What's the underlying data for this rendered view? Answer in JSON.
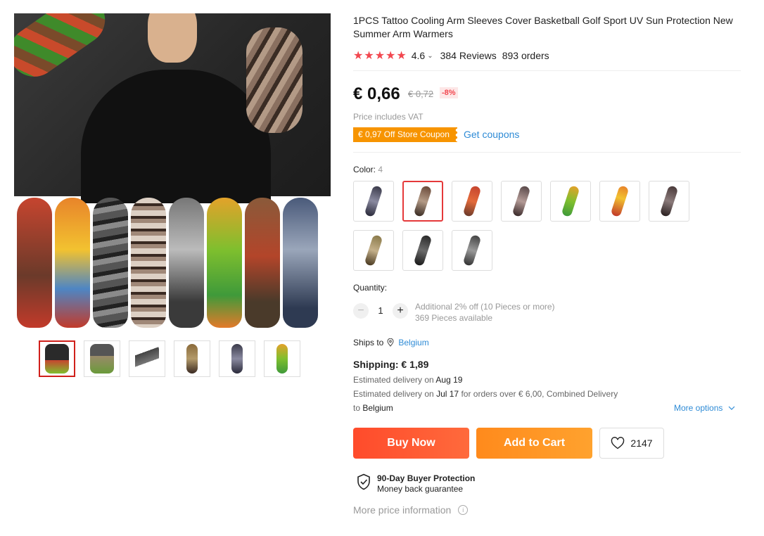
{
  "product": {
    "title": "1PCS Tattoo Cooling Arm Sleeves Cover Basketball Golf Sport UV Sun Protection New Summer Arm Warmers",
    "stars": "★★★★★",
    "rating": "4.6",
    "reviews": "384 Reviews",
    "orders": "893 orders"
  },
  "price": {
    "current": "€ 0,66",
    "original": "€ 0,72",
    "discount": "-8%",
    "vat_note": "Price includes VAT",
    "coupon": "€ 0,97 Off Store Coupon",
    "get_coupons": "Get coupons"
  },
  "color": {
    "label": "Color:",
    "value": "4",
    "selected_index": 1,
    "swatches": [
      {
        "name": "swatch-1"
      },
      {
        "name": "swatch-2"
      },
      {
        "name": "swatch-3"
      },
      {
        "name": "swatch-4"
      },
      {
        "name": "swatch-5"
      },
      {
        "name": "swatch-6"
      },
      {
        "name": "swatch-7"
      },
      {
        "name": "swatch-8"
      },
      {
        "name": "swatch-9"
      },
      {
        "name": "swatch-10"
      }
    ]
  },
  "quantity": {
    "label": "Quantity:",
    "minus": "−",
    "plus": "+",
    "value": "1",
    "note_discount": "Additional 2% off (10 Pieces or more)",
    "note_available": "369 Pieces available"
  },
  "shipping": {
    "ships_to_label": "Ships to",
    "country": "Belgium",
    "cost": "Shipping: € 1,89",
    "est1_prefix": "Estimated delivery on",
    "est1_date": "Aug 19",
    "est2_prefix": "Estimated delivery on",
    "est2_date": "Jul 17",
    "est2_suffix": "for orders over € 6,00, Combined Delivery",
    "est3_prefix": "to",
    "est3_country": "Belgium",
    "more_options": "More options"
  },
  "actions": {
    "buy_now": "Buy Now",
    "add_to_cart": "Add to Cart",
    "wishlist_count": "2147"
  },
  "protection": {
    "title": "90-Day Buyer Protection",
    "subtitle": "Money back guarantee"
  },
  "more_price_info": "More price information",
  "colors": {
    "accent_red": "#f2474f",
    "coupon_orange": "#f79400",
    "link_blue": "#2e8bd6",
    "buy_now": "#ff4b2b",
    "add_to_cart": "#ff8a1c"
  },
  "gallery": {
    "thumbnails": [
      "thumb-1",
      "thumb-2",
      "thumb-3",
      "thumb-4",
      "thumb-5",
      "thumb-6"
    ],
    "selected_index": 0
  }
}
